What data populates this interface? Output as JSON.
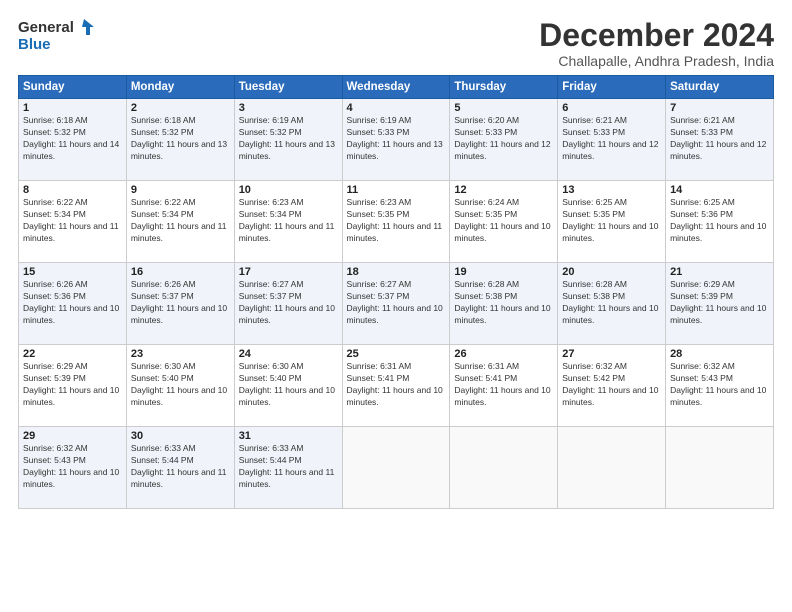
{
  "logo": {
    "line1": "General",
    "line2": "Blue"
  },
  "title": "December 2024",
  "location": "Challapalle, Andhra Pradesh, India",
  "days_of_week": [
    "Sunday",
    "Monday",
    "Tuesday",
    "Wednesday",
    "Thursday",
    "Friday",
    "Saturday"
  ],
  "weeks": [
    [
      {
        "day": "1",
        "sunrise": "6:18 AM",
        "sunset": "5:32 PM",
        "daylight": "11 hours and 14 minutes."
      },
      {
        "day": "2",
        "sunrise": "6:18 AM",
        "sunset": "5:32 PM",
        "daylight": "11 hours and 13 minutes."
      },
      {
        "day": "3",
        "sunrise": "6:19 AM",
        "sunset": "5:32 PM",
        "daylight": "11 hours and 13 minutes."
      },
      {
        "day": "4",
        "sunrise": "6:19 AM",
        "sunset": "5:33 PM",
        "daylight": "11 hours and 13 minutes."
      },
      {
        "day": "5",
        "sunrise": "6:20 AM",
        "sunset": "5:33 PM",
        "daylight": "11 hours and 12 minutes."
      },
      {
        "day": "6",
        "sunrise": "6:21 AM",
        "sunset": "5:33 PM",
        "daylight": "11 hours and 12 minutes."
      },
      {
        "day": "7",
        "sunrise": "6:21 AM",
        "sunset": "5:33 PM",
        "daylight": "11 hours and 12 minutes."
      }
    ],
    [
      {
        "day": "8",
        "sunrise": "6:22 AM",
        "sunset": "5:34 PM",
        "daylight": "11 hours and 11 minutes."
      },
      {
        "day": "9",
        "sunrise": "6:22 AM",
        "sunset": "5:34 PM",
        "daylight": "11 hours and 11 minutes."
      },
      {
        "day": "10",
        "sunrise": "6:23 AM",
        "sunset": "5:34 PM",
        "daylight": "11 hours and 11 minutes."
      },
      {
        "day": "11",
        "sunrise": "6:23 AM",
        "sunset": "5:35 PM",
        "daylight": "11 hours and 11 minutes."
      },
      {
        "day": "12",
        "sunrise": "6:24 AM",
        "sunset": "5:35 PM",
        "daylight": "11 hours and 10 minutes."
      },
      {
        "day": "13",
        "sunrise": "6:25 AM",
        "sunset": "5:35 PM",
        "daylight": "11 hours and 10 minutes."
      },
      {
        "day": "14",
        "sunrise": "6:25 AM",
        "sunset": "5:36 PM",
        "daylight": "11 hours and 10 minutes."
      }
    ],
    [
      {
        "day": "15",
        "sunrise": "6:26 AM",
        "sunset": "5:36 PM",
        "daylight": "11 hours and 10 minutes."
      },
      {
        "day": "16",
        "sunrise": "6:26 AM",
        "sunset": "5:37 PM",
        "daylight": "11 hours and 10 minutes."
      },
      {
        "day": "17",
        "sunrise": "6:27 AM",
        "sunset": "5:37 PM",
        "daylight": "11 hours and 10 minutes."
      },
      {
        "day": "18",
        "sunrise": "6:27 AM",
        "sunset": "5:37 PM",
        "daylight": "11 hours and 10 minutes."
      },
      {
        "day": "19",
        "sunrise": "6:28 AM",
        "sunset": "5:38 PM",
        "daylight": "11 hours and 10 minutes."
      },
      {
        "day": "20",
        "sunrise": "6:28 AM",
        "sunset": "5:38 PM",
        "daylight": "11 hours and 10 minutes."
      },
      {
        "day": "21",
        "sunrise": "6:29 AM",
        "sunset": "5:39 PM",
        "daylight": "11 hours and 10 minutes."
      }
    ],
    [
      {
        "day": "22",
        "sunrise": "6:29 AM",
        "sunset": "5:39 PM",
        "daylight": "11 hours and 10 minutes."
      },
      {
        "day": "23",
        "sunrise": "6:30 AM",
        "sunset": "5:40 PM",
        "daylight": "11 hours and 10 minutes."
      },
      {
        "day": "24",
        "sunrise": "6:30 AM",
        "sunset": "5:40 PM",
        "daylight": "11 hours and 10 minutes."
      },
      {
        "day": "25",
        "sunrise": "6:31 AM",
        "sunset": "5:41 PM",
        "daylight": "11 hours and 10 minutes."
      },
      {
        "day": "26",
        "sunrise": "6:31 AM",
        "sunset": "5:41 PM",
        "daylight": "11 hours and 10 minutes."
      },
      {
        "day": "27",
        "sunrise": "6:32 AM",
        "sunset": "5:42 PM",
        "daylight": "11 hours and 10 minutes."
      },
      {
        "day": "28",
        "sunrise": "6:32 AM",
        "sunset": "5:43 PM",
        "daylight": "11 hours and 10 minutes."
      }
    ],
    [
      {
        "day": "29",
        "sunrise": "6:32 AM",
        "sunset": "5:43 PM",
        "daylight": "11 hours and 10 minutes."
      },
      {
        "day": "30",
        "sunrise": "6:33 AM",
        "sunset": "5:44 PM",
        "daylight": "11 hours and 11 minutes."
      },
      {
        "day": "31",
        "sunrise": "6:33 AM",
        "sunset": "5:44 PM",
        "daylight": "11 hours and 11 minutes."
      },
      null,
      null,
      null,
      null
    ]
  ]
}
